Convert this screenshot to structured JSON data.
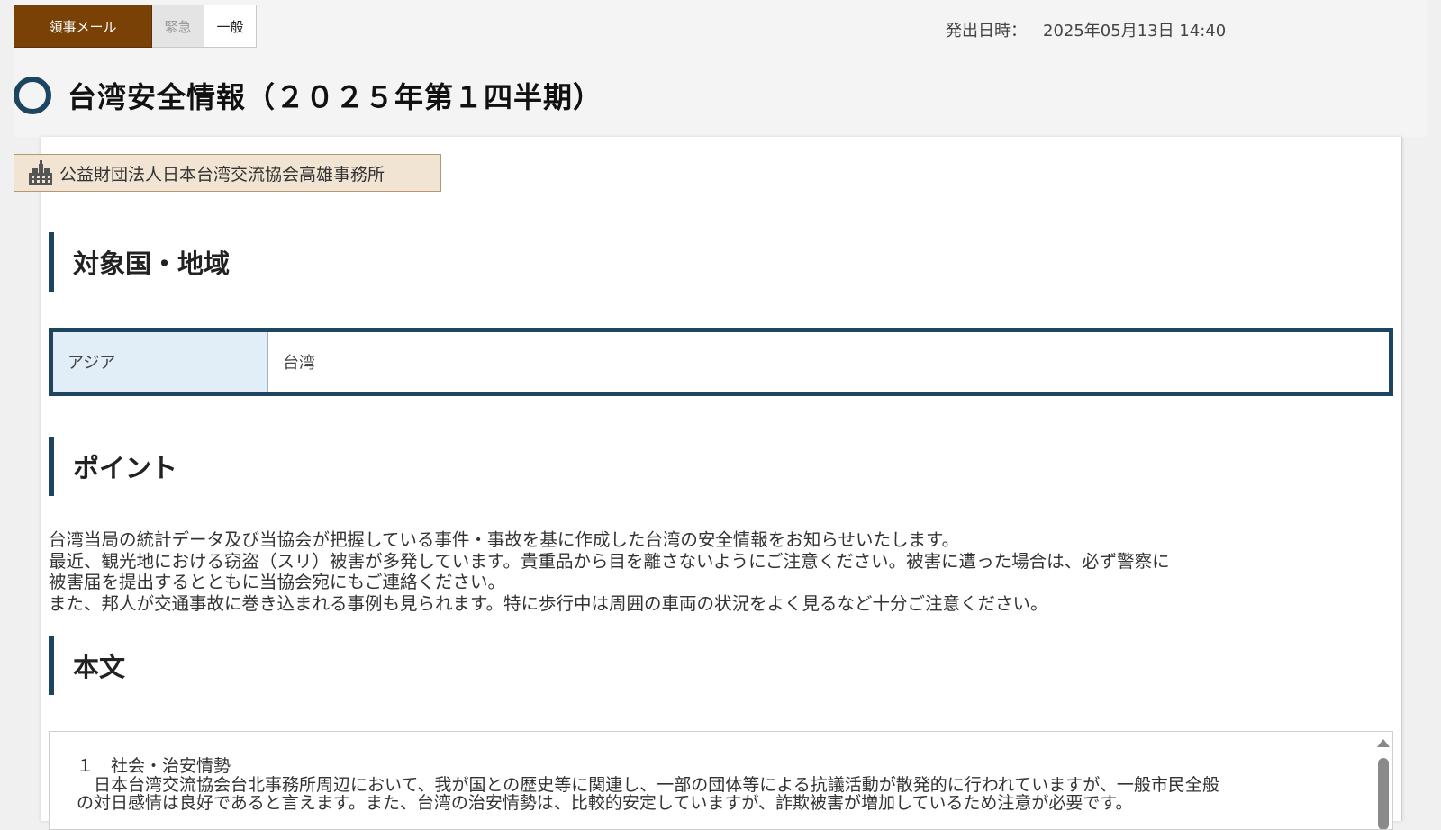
{
  "tabs": {
    "consular_mail": "領事メール",
    "urgent": "緊急",
    "general": "一般"
  },
  "issued": {
    "label": "発出日時：",
    "value": "2025年05月13日 14:40"
  },
  "title": "台湾安全情報（２０２５年第１四半期）",
  "sender": {
    "icon": "building-icon",
    "name": "公益財団法人日本台湾交流協会高雄事務所"
  },
  "sections": {
    "region_heading": "対象国・地域",
    "points_heading": "ポイント",
    "body_heading": "本文"
  },
  "region": {
    "area": "アジア",
    "country": "台湾"
  },
  "points": [
    "台湾当局の統計データ及び当協会が把握している事件・事故を基に作成した台湾の安全情報をお知らせいたします。",
    "最近、観光地における窃盗（スリ）被害が多発しています。貴重品から目を離さないようにご注意ください。被害に遭った場合は、必ず警察に",
    "被害届を提出するとともに当協会宛にもご連絡ください。",
    "また、邦人が交通事故に巻き込まれる事例も見られます。特に歩行中は周囲の車両の状況をよく見るなど十分ご注意ください。"
  ],
  "body": [
    "１　社会・治安情勢",
    "　日本台湾交流協会台北事務所周辺において、我が国との歴史等に関連し、一部の団体等による抗議活動が散発的に行われていますが、一般市民全般",
    "の対日感情は良好であると言えます。また、台湾の治安情勢は、比較的安定していますが、詐欺被害が増加しているため注意が必要です。"
  ],
  "colors": {
    "brand_brown": "#7a4106",
    "accent_navy": "#1d4560",
    "region_bg": "#e1eef8",
    "sender_bg": "#f1e4d3"
  }
}
